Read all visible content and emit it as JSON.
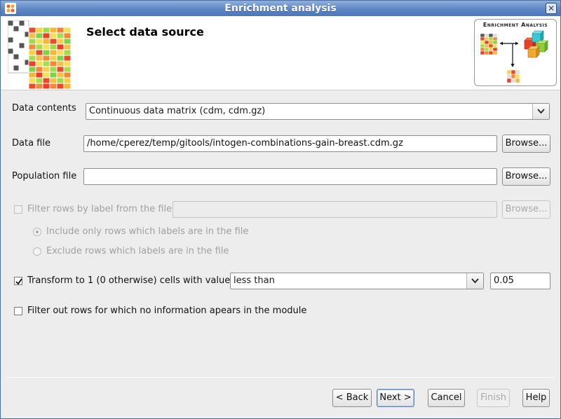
{
  "window": {
    "title": "Enrichment analysis",
    "close_glyph": "✕",
    "app_icon": "app-logo-icon",
    "colors": {
      "titlebar": "#5f86c4",
      "background": "#ededed"
    }
  },
  "header": {
    "title": "Select data source",
    "logo_caption": "Enrichment Analysis"
  },
  "form": {
    "data_contents": {
      "label": "Data contents",
      "value": "Continuous data matrix (cdm, cdm.gz)"
    },
    "data_file": {
      "label": "Data file",
      "value": "/home/cperez/temp/gitools/intogen-combinations-gain-breast.cdm.gz",
      "browse_label": "Browse..."
    },
    "population_file": {
      "label": "Population file",
      "value": "",
      "browse_label": "Browse..."
    },
    "filter_rows": {
      "label": "Filter rows by label from the file",
      "checked": false,
      "value": "",
      "browse_label": "Browse...",
      "include_label": "Include only rows which labels are in the file",
      "exclude_label": "Exclude rows which labels are in the file"
    },
    "transform": {
      "label": "Transform to 1 (0 otherwise) cells with value",
      "checked": true,
      "comparator": "less than",
      "cutoff": "0.05"
    },
    "filter_out": {
      "label": "Filter out rows for which no information apears in the module",
      "checked": false
    }
  },
  "buttons": {
    "back": "< Back",
    "next": "Next >",
    "cancel": "Cancel",
    "finish": "Finish",
    "help": "Help"
  }
}
